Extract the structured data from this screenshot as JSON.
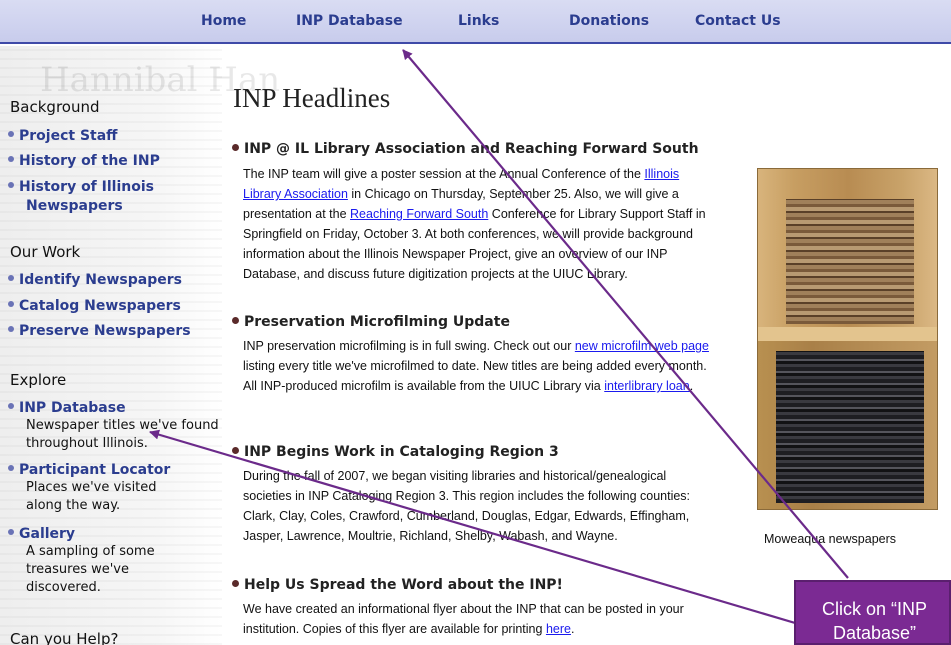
{
  "nav": {
    "home": "Home",
    "inp_database": "INP Database",
    "links": "Links",
    "donations": "Donations",
    "contact_us": "Contact Us"
  },
  "sidebar": {
    "watermark": "Hannibal Han",
    "background": {
      "heading": "Background",
      "items": [
        "Project Staff",
        "History of the INP",
        "History of Illinois",
        "Newspapers"
      ]
    },
    "our_work": {
      "heading": "Our Work",
      "items": [
        "Identify Newspapers",
        "Catalog Newspapers",
        "Preserve Newspapers"
      ]
    },
    "explore": {
      "heading": "Explore",
      "items": [
        {
          "label": "INP Database",
          "desc": "Newspaper titles we've found throughout Illinois."
        },
        {
          "label": "Participant Locator",
          "desc": "Places we've visited along the way."
        },
        {
          "label": "Gallery",
          "desc": "A sampling of some treasures we've discovered."
        }
      ]
    },
    "can_you_help": "Can you Help?"
  },
  "main": {
    "title": "INP Headlines",
    "news": [
      {
        "heading": "INP @ IL Library Association and Reaching Forward South",
        "p1": "The INP team will give a poster session at the Annual Conference of the ",
        "link1": "Illinois Library Association",
        "p2": " in Chicago on Thursday, September 25. Also, we will give a presentation at the ",
        "link2": "Reaching Forward South",
        "p3": " Conference for Library Support Staff in Springfield on Friday, October 3. At both conferences, we will provide background information about the Illinois Newspaper Project, give an overview of our INP Database, and discuss future digitization projects at the UIUC Library."
      },
      {
        "heading": "Preservation Microfilming Update",
        "p1": "INP preservation microfilming is in full swing. Check out our ",
        "link1": "new microfilm web page",
        "p2": " listing every title we've microfilmed to date. New titles are being added every month. All INP-produced microfilm is available from the UIUC Library via ",
        "link2": "interlibrary loan",
        "p3": "."
      },
      {
        "heading": "INP Begins Work in Cataloging Region 3",
        "p1": "During the fall of 2007, we began visiting libraries and historical/genealogical societies in INP Cataloging Region 3. This region includes the following counties: Clark, Clay, Coles, Crawford, Cumberland, Douglas, Edgar, Edwards, Effingham, Jasper, Lawrence, Moultrie, Richland, Shelby, Wabash, and Wayne."
      },
      {
        "heading": "Help Us Spread the Word about the INP!",
        "p1": "We have created an informational flyer about the INP that can be posted in your institution. Copies of this flyer are available for printing ",
        "link1": "here",
        "p2": "."
      }
    ],
    "photo_caption": "Moweaqua newspapers"
  },
  "callout": {
    "text_line1": "Click on “INP",
    "text_line2": "Database”",
    "color": "#7b2a93"
  },
  "colors": {
    "nav_bg": "#c8ccec",
    "link_blue": "#2b3d8f",
    "arrow": "#6b2a8a"
  }
}
